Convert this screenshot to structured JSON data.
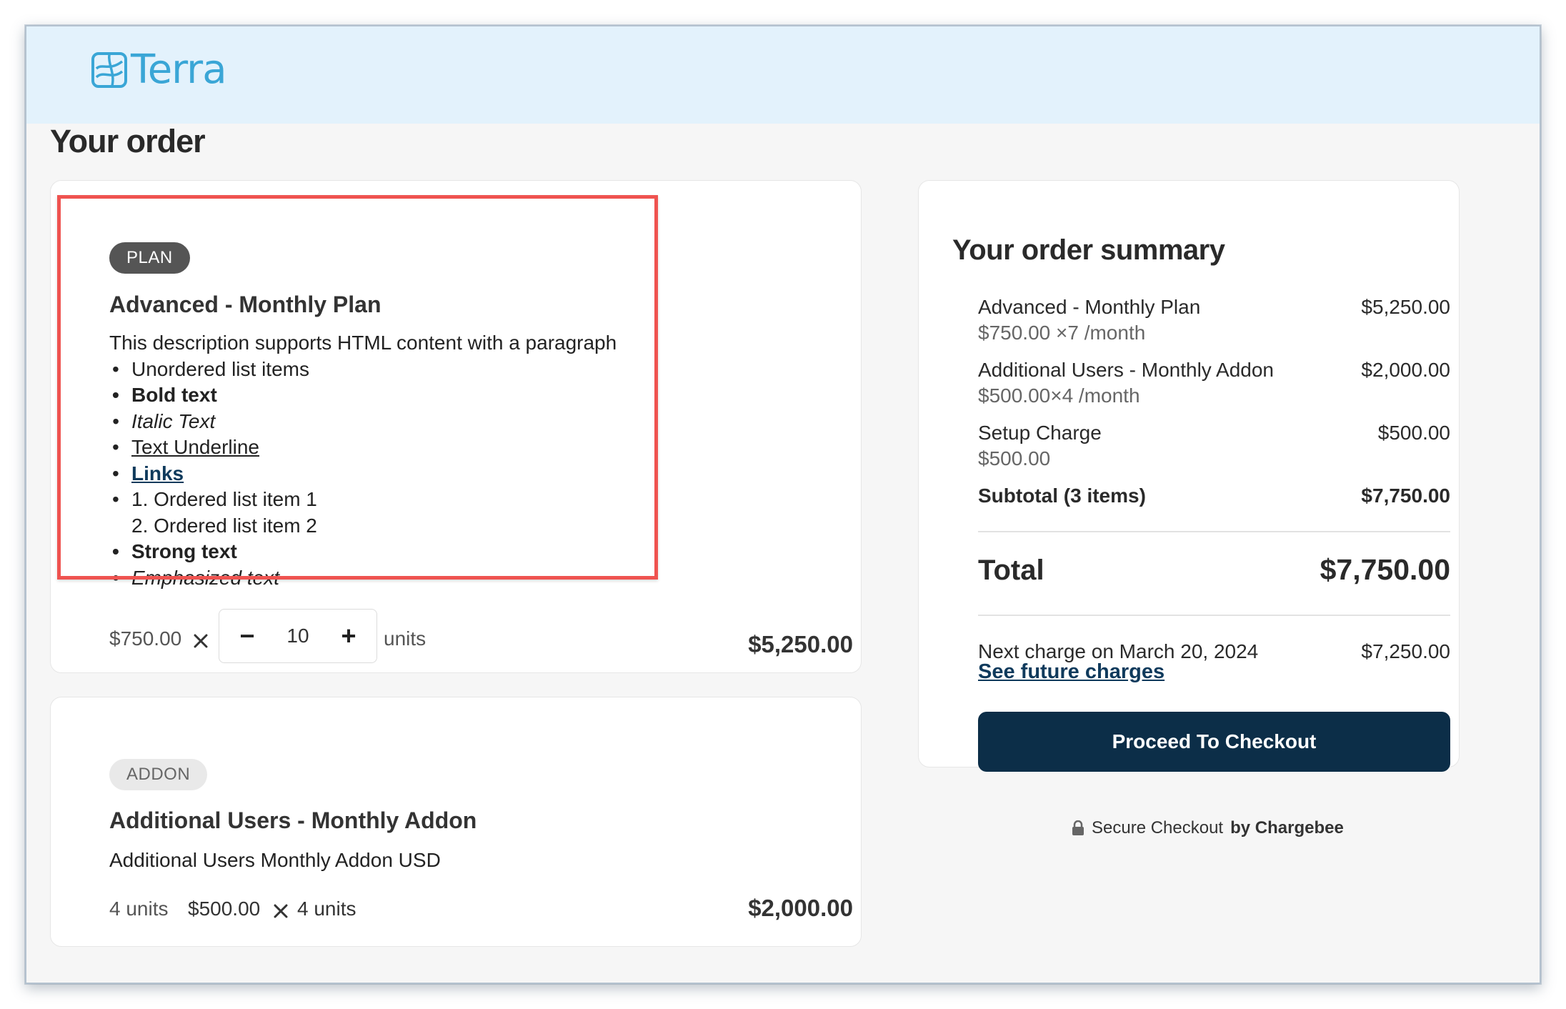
{
  "brand": {
    "name": "Terra",
    "color": "#3aa6d6",
    "logo_icon": "terra-logo-icon"
  },
  "page": {
    "title": "Your order"
  },
  "plan_item": {
    "badge": "PLAN",
    "title": "Advanced - Monthly Plan",
    "description": {
      "paragraph": "This description supports HTML content with a paragraph",
      "bullets": {
        "unordered": "Unordered list items",
        "bold": "Bold text",
        "italic": "Italic Text",
        "underline": "Text Underline",
        "links": "Links",
        "ordered_1": "1. Ordered list item 1",
        "ordered_2": "2. Ordered list item 2",
        "strong": "Strong text",
        "emphasized": "Emphasized text"
      }
    },
    "unit_price": "$750.00",
    "quantity": "10",
    "unit_label": "units",
    "amount": "$5,250.00"
  },
  "addon_item": {
    "badge": "ADDON",
    "title": "Additional Users - Monthly Addon",
    "description": "Additional Users Monthly Addon USD",
    "quantity_text": "4 units",
    "unit_price": "$500.00",
    "multiplier_text": "4 units",
    "amount": "$2,000.00"
  },
  "summary": {
    "title": "Your order summary",
    "lines": [
      {
        "name": "Advanced - Monthly Plan",
        "detail": "$750.00 ×7 /month",
        "amount": "$5,250.00"
      },
      {
        "name": "Additional Users - Monthly Addon",
        "detail": "$500.00×4 /month",
        "amount": "$2,000.00"
      },
      {
        "name": "Setup Charge",
        "detail": "$500.00",
        "amount": "$500.00"
      }
    ],
    "subtotal_label": "Subtotal (3 items)",
    "subtotal_amount": "$7,750.00",
    "total_label": "Total",
    "total_amount": "$7,750.00",
    "next_charge_label": "Next charge on March 20, 2024",
    "next_charge_amount": "$7,250.00",
    "future_charges_link": "See future charges",
    "checkout_button": "Proceed To Checkout"
  },
  "footer": {
    "secure_text": "Secure Checkout",
    "by_text": "by Chargebee",
    "icon": "lock-icon"
  },
  "colors": {
    "header_bg": "#e3f2fc",
    "button_bg": "#0c2e48",
    "link": "#0f3a5c",
    "highlight": "#ef5350"
  }
}
